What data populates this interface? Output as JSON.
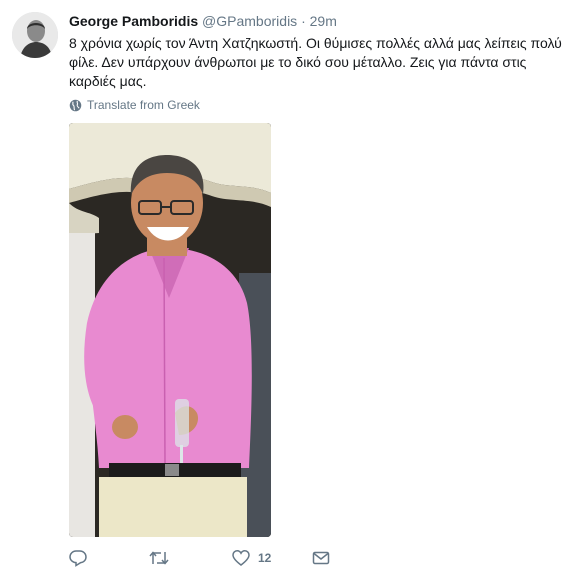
{
  "tweet": {
    "author_name": "George Pamboridis",
    "handle": "@GPamboridis",
    "separator": "·",
    "time": "29m",
    "text_lines": [
      "8 χρόνια χωρίς τον Άντη Χατζηκωστή. Οι θύμισες πολλές αλλά μας λείπεις πολύ",
      "φίλε. Δεν υπάρχουν άνθρωποι με το δικό σου μέταλλο. Ζεις για πάντα στις",
      "καρδιές μας."
    ],
    "translate_label": "Translate from Greek",
    "like_count": "12"
  },
  "icons": {
    "avatar": "profile-photo",
    "caret": "chevron-down-icon",
    "translate": "globe-icon",
    "reply": "reply-icon",
    "retweet": "retweet-icon",
    "like": "heart-icon",
    "dm": "envelope-icon"
  },
  "colors": {
    "text_primary": "#14171a",
    "text_secondary": "#657786",
    "shirt": "#e88ad0"
  }
}
